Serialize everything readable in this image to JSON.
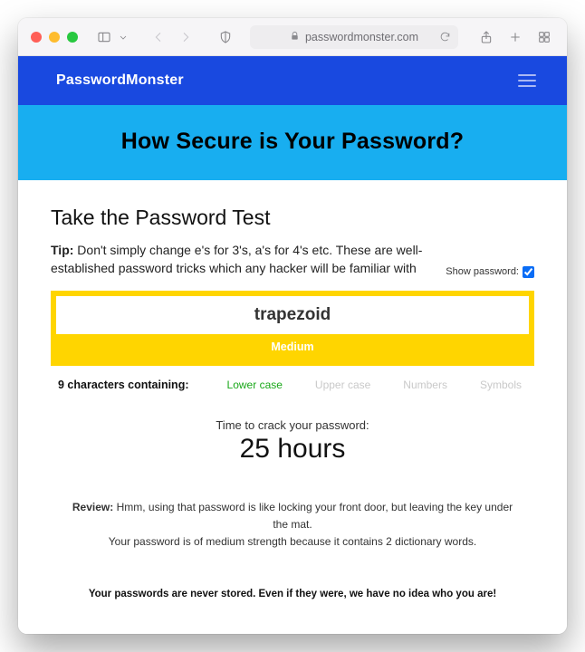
{
  "browser": {
    "url_host": "passwordmonster.com"
  },
  "navbar": {
    "brand": "PasswordMonster"
  },
  "hero": {
    "title": "How Secure is Your Password?"
  },
  "test": {
    "heading": "Take the Password Test",
    "tip_label": "Tip:",
    "tip_text": "Don't simply change e's for 3's, a's for 4's etc. These are well-established password tricks which any hacker will be familiar with",
    "show_password_label": "Show password:",
    "show_password_checked": true,
    "input_value": "trapezoid",
    "strength_label": "Medium",
    "strength_color": "#ffd500",
    "char_summary": "9 characters containing:",
    "char_types": {
      "lower": {
        "label": "Lower case",
        "active": true
      },
      "upper": {
        "label": "Upper case",
        "active": false
      },
      "numbers": {
        "label": "Numbers",
        "active": false
      },
      "symbols": {
        "label": "Symbols",
        "active": false
      }
    },
    "crack_label": "Time to crack your password:",
    "crack_time": "25 hours",
    "review_label": "Review:",
    "review_text_1": "Hmm, using that password is like locking your front door, but leaving the key under the mat.",
    "review_text_2": "Your password is of medium strength because it contains 2 dictionary words.",
    "disclaimer": "Your passwords are never stored. Even if they were, we have no idea who you are!"
  }
}
